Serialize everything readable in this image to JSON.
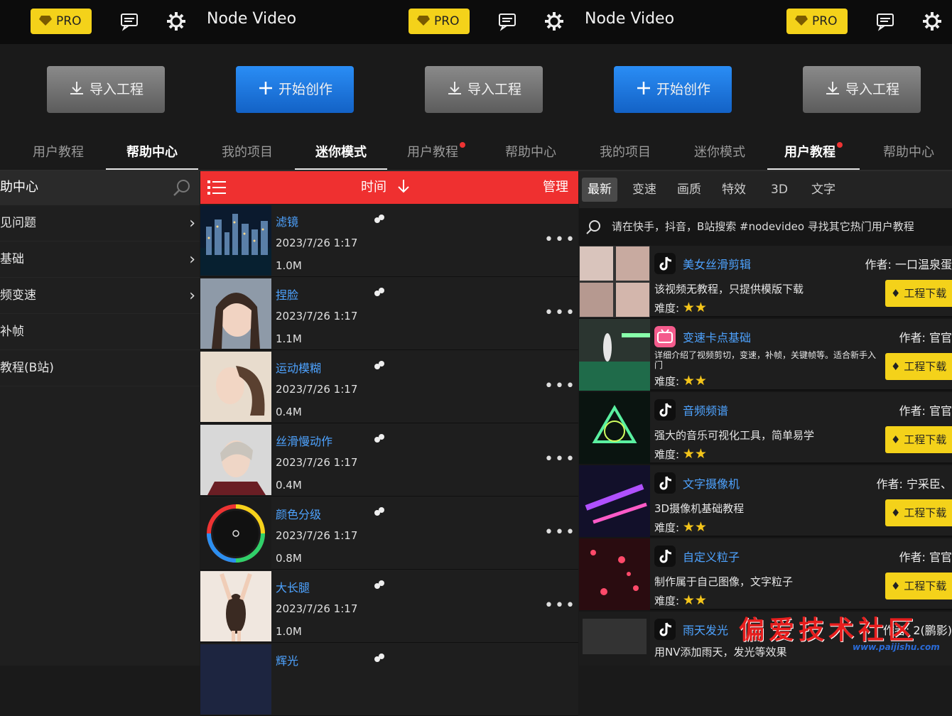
{
  "topbar": {
    "pro_label": "PRO",
    "app_title": "Node Video"
  },
  "buttons": {
    "import_label": "导入工程",
    "create_label": "开始创作"
  },
  "tabs": [
    "用户教程",
    "帮助中心",
    "我的项目",
    "迷你模式",
    "用户教程",
    "帮助中心",
    "我的项目",
    "迷你模式",
    "用户教程",
    "帮助中心"
  ],
  "help": {
    "title": "助中心",
    "items": [
      "见问题",
      "基础",
      "频变速",
      "补帧",
      "教程(B站)"
    ]
  },
  "projects": {
    "sort_label": "时间",
    "manage_label": "管理",
    "rows": [
      {
        "name": "滤镜",
        "date": "2023/7/26 1:17",
        "size": "1.0M"
      },
      {
        "name": "捏脸",
        "date": "2023/7/26 1:17",
        "size": "1.1M"
      },
      {
        "name": "运动模糊",
        "date": "2023/7/26 1:17",
        "size": "0.4M"
      },
      {
        "name": "丝滑慢动作",
        "date": "2023/7/26 1:17",
        "size": "0.4M"
      },
      {
        "name": "颜色分级",
        "date": "2023/7/26 1:17",
        "size": "0.8M"
      },
      {
        "name": "大长腿",
        "date": "2023/7/26 1:17",
        "size": "1.0M"
      },
      {
        "name": "辉光",
        "date": "",
        "size": ""
      }
    ],
    "more_label": "•••"
  },
  "tutorials": {
    "categories": [
      "最新",
      "变速",
      "画质",
      "特效",
      "3D",
      "文字"
    ],
    "search_text": "请在快手，抖音，B站搜索 #nodevideo 寻找其它热门用户教程",
    "difficulty_label": "难度:",
    "download_label": "工程下载",
    "rows": [
      {
        "name": "美女丝滑剪辑",
        "author": "作者: 一口温泉蛋",
        "desc": "该视频无教程，只提供模版下载"
      },
      {
        "name": "变速卡点基础",
        "author": "作者: 官官",
        "desc": "详细介绍了视频剪切，变速，补帧，关键帧等。适合新手入门"
      },
      {
        "name": "音频频谱",
        "author": "作者: 官官",
        "desc": "强大的音乐可视化工具，简单易学"
      },
      {
        "name": "文字摄像机",
        "author": "作者: 宁采臣、",
        "desc": "3D摄像机基础教程"
      },
      {
        "name": "自定义粒子",
        "author": "作者: 官官",
        "desc": "制作属于自己图像，文字粒子"
      },
      {
        "name": "雨天发光",
        "author": "作者: 2(鹏影)",
        "desc": "用NV添加雨天，发光等效果"
      }
    ]
  },
  "watermark": {
    "text": "偏爱技术社区",
    "url": "www.paijishu.com"
  },
  "colors": {
    "accent_red": "#ef3030",
    "pro_yellow": "#f4d21a",
    "create_blue": "#1e7be0",
    "link_blue": "#4ea3ff"
  }
}
